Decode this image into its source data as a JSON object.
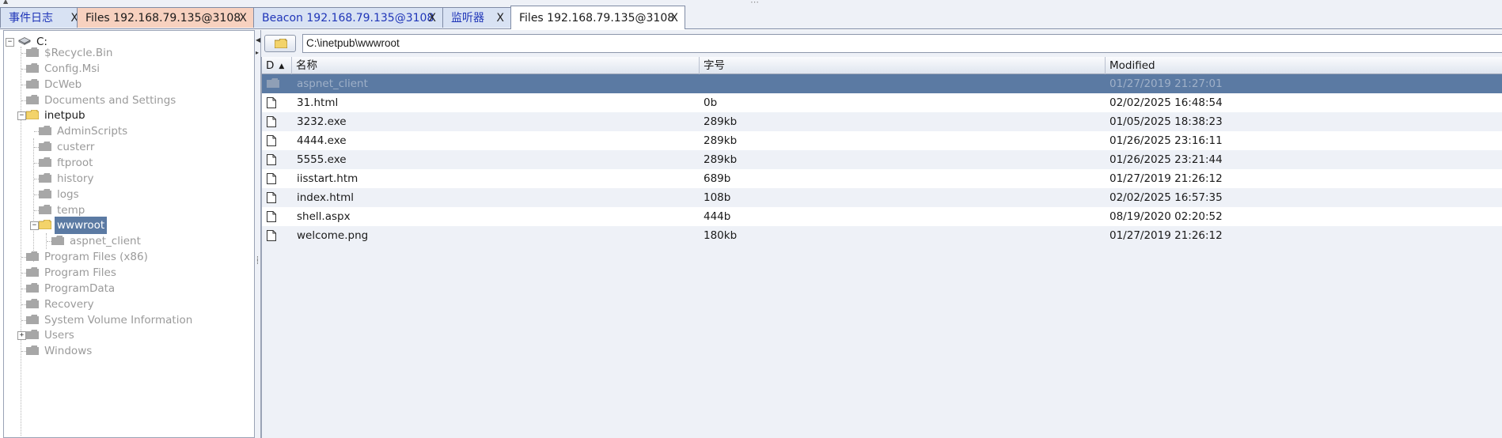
{
  "tabs": [
    {
      "label": "事件日志",
      "close": "X",
      "style": "blue"
    },
    {
      "label": "Files 192.168.79.135@3108",
      "close": "X",
      "style": "salmon"
    },
    {
      "label": "Beacon 192.168.79.135@3108",
      "close": "X",
      "style": "blue"
    },
    {
      "label": "监听器",
      "close": "X",
      "style": "blue"
    },
    {
      "label": "Files 192.168.79.135@3108",
      "close": "X",
      "style": "active"
    }
  ],
  "tree": {
    "root": "C:",
    "items": [
      {
        "label": "$Recycle.Bin",
        "state": "grey"
      },
      {
        "label": "Config.Msi",
        "state": "grey"
      },
      {
        "label": "DcWeb",
        "state": "grey"
      },
      {
        "label": "Documents and Settings",
        "state": "grey"
      },
      {
        "label": "inetpub",
        "state": "open"
      },
      {
        "label": "AdminScripts",
        "state": "grey"
      },
      {
        "label": "custerr",
        "state": "grey"
      },
      {
        "label": "ftproot",
        "state": "grey"
      },
      {
        "label": "history",
        "state": "grey"
      },
      {
        "label": "logs",
        "state": "grey"
      },
      {
        "label": "temp",
        "state": "grey"
      },
      {
        "label": "wwwroot",
        "state": "selected"
      },
      {
        "label": "aspnet_client",
        "state": "grey"
      },
      {
        "label": "Program Files (x86)",
        "state": "grey"
      },
      {
        "label": "Program Files",
        "state": "grey"
      },
      {
        "label": "ProgramData",
        "state": "grey"
      },
      {
        "label": "Recovery",
        "state": "grey"
      },
      {
        "label": "System Volume Information",
        "state": "grey"
      },
      {
        "label": "Users",
        "state": "grey"
      },
      {
        "label": "Windows",
        "state": "grey"
      }
    ]
  },
  "path": {
    "value": "C:\\inetpub\\wwwroot"
  },
  "table": {
    "columns": {
      "d": "D",
      "name": "名称",
      "size": "字号",
      "modified": "Modified"
    },
    "sort_indicator": "▲",
    "rows": [
      {
        "type": "folder",
        "name": "aspnet_client",
        "size": "",
        "modified": "01/27/2019 21:27:01"
      },
      {
        "type": "file",
        "name": "31.html",
        "size": "0b",
        "modified": "02/02/2025 16:48:54"
      },
      {
        "type": "file",
        "name": "3232.exe",
        "size": "289kb",
        "modified": "01/05/2025 18:38:23"
      },
      {
        "type": "file",
        "name": "4444.exe",
        "size": "289kb",
        "modified": "01/26/2025 23:16:11"
      },
      {
        "type": "file",
        "name": "5555.exe",
        "size": "289kb",
        "modified": "01/26/2025 23:21:44"
      },
      {
        "type": "file",
        "name": "iisstart.htm",
        "size": "689b",
        "modified": "01/27/2019 21:26:12"
      },
      {
        "type": "file",
        "name": "index.html",
        "size": "108b",
        "modified": "02/02/2025 16:57:35"
      },
      {
        "type": "file",
        "name": "shell.aspx",
        "size": "444b",
        "modified": "08/19/2020 02:20:52"
      },
      {
        "type": "file",
        "name": "welcome.png",
        "size": "180kb",
        "modified": "01/27/2019 21:26:12"
      }
    ]
  },
  "colors": {
    "selection": "#5b7aa3",
    "tab_blue_text": "#1f35b8",
    "tab_salmon_bg": "#f7d1bf",
    "folder_yellow": "#f3d36a",
    "folder_grey": "#a7a7a7"
  }
}
